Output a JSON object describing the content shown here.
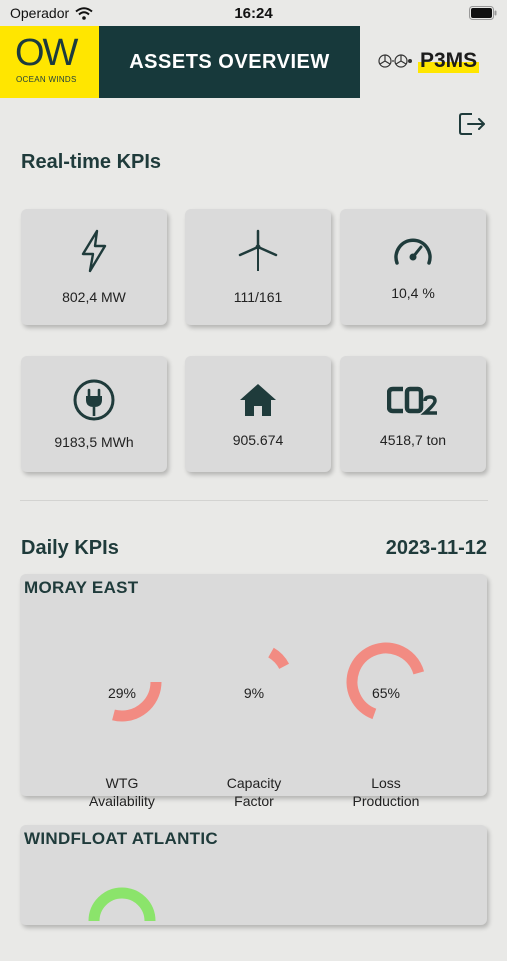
{
  "status_bar": {
    "carrier": "Operador",
    "time": "16:24"
  },
  "header": {
    "logo_mark": "OW",
    "logo_sub": "OCEAN WINDS",
    "title": "ASSETS OVERVIEW",
    "brand": "P3MS"
  },
  "realtime": {
    "title": "Real-time KPIs",
    "cards": [
      {
        "icon": "lightning-icon",
        "value": "802,4 MW"
      },
      {
        "icon": "wind-turbine-icon",
        "value": "111/161"
      },
      {
        "icon": "speedometer-icon",
        "value": "10,4 %"
      },
      {
        "icon": "ev-plug-icon",
        "value": "9183,5 MWh"
      },
      {
        "icon": "house-icon",
        "value": "905.674"
      },
      {
        "icon": "co2-icon",
        "value": "4518,7 ton"
      }
    ]
  },
  "daily": {
    "title": "Daily KPIs",
    "date": "2023-11-12",
    "sites": [
      {
        "name": "MORAY EAST",
        "gauges": [
          {
            "value_text": "29%",
            "fraction": 0.29,
            "label_line1": "WTG",
            "label_line2": "Availability"
          },
          {
            "value_text": "9%",
            "fraction": 0.09,
            "label_line1": "Capacity",
            "label_line2": "Factor"
          },
          {
            "value_text": "65%",
            "fraction": 0.65,
            "label_line1": "Loss",
            "label_line2": "Production"
          }
        ]
      },
      {
        "name": "WINDFLOAT ATLANTIC"
      }
    ]
  },
  "colors": {
    "gauge_red": "#f28b82",
    "gauge_green": "#8be46b",
    "header_dark": "#17393b",
    "brand_yellow": "#ffe600"
  }
}
